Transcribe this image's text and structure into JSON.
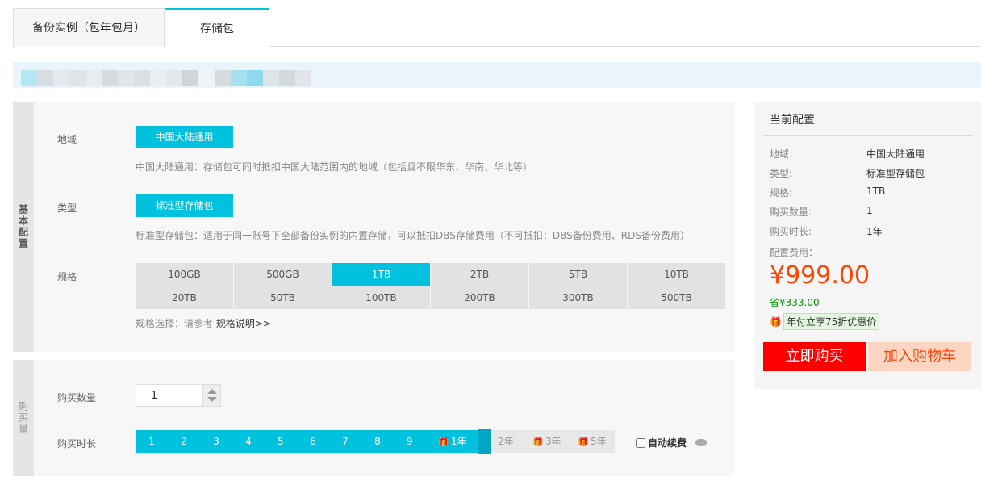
{
  "tabs": [
    {
      "label": "备份实例（包年包月）"
    },
    {
      "label": "存储包"
    }
  ],
  "basic": {
    "side_label": "基本配置",
    "region": {
      "label": "地域",
      "selected": "中国大陆通用",
      "description": "中国大陆通用：存储包可同时抵扣中国大陆范围内的地域（包括且不限华东、华南、华北等）"
    },
    "type": {
      "label": "类型",
      "selected": "标准型存储包",
      "description": "标准型存储包：适用于同一账号下全部备份实例的内置存储，可以抵扣DBS存储费用（不可抵扣：DBS备份费用、RDS备份费用）"
    },
    "spec": {
      "label": "规格",
      "options": [
        "100GB",
        "500GB",
        "1TB",
        "2TB",
        "5TB",
        "10TB",
        "20TB",
        "50TB",
        "100TB",
        "200TB",
        "300TB",
        "500TB"
      ],
      "selected": "1TB",
      "tip_prefix": "规格选择：请参考",
      "tip_link": "规格说明>>"
    }
  },
  "purchase": {
    "side_label": "购买量",
    "quantity": {
      "label": "购买数量",
      "value": "1"
    },
    "duration": {
      "label": "购买时长",
      "months": [
        "1",
        "2",
        "3",
        "4",
        "5",
        "6",
        "7",
        "8",
        "9"
      ],
      "year1": "1年",
      "year2": "2年",
      "year3": "3年",
      "year5": "5年",
      "selected": "1年"
    },
    "auto_renew": "自动续费"
  },
  "summary": {
    "title": "当前配置",
    "rows": [
      {
        "key": "地域:",
        "value": "中国大陆通用"
      },
      {
        "key": "类型:",
        "value": "标准型存储包"
      },
      {
        "key": "规格:",
        "value": "1TB"
      },
      {
        "key": "购买数量:",
        "value": "1"
      },
      {
        "key": "购买时长:",
        "value": "1年"
      }
    ],
    "fee_label": "配置费用：",
    "price": "¥999.00",
    "save": "省¥333.00",
    "promo": "年付立享75折优惠价",
    "buy_label": "立即购买",
    "cart_label": "加入购物车"
  },
  "colors": {
    "accent": "#00c1de",
    "price": "#ff4400",
    "buy": "#ff0000"
  }
}
